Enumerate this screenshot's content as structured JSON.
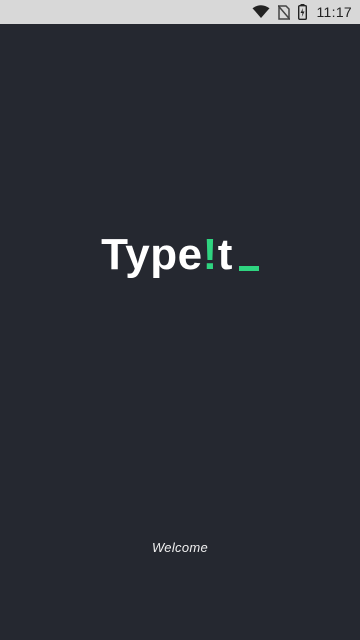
{
  "status_bar": {
    "time": "11:17",
    "icons": [
      "wifi-icon",
      "no-sim-icon",
      "battery-charging-icon"
    ]
  },
  "logo": {
    "part1": "Type",
    "accent": "!",
    "part2": "t",
    "accent_color": "#2fd480"
  },
  "splash": {
    "welcome_text": "Welcome"
  },
  "colors": {
    "background": "#252830",
    "status_bar": "#d8d8d8",
    "accent": "#2fd480"
  }
}
